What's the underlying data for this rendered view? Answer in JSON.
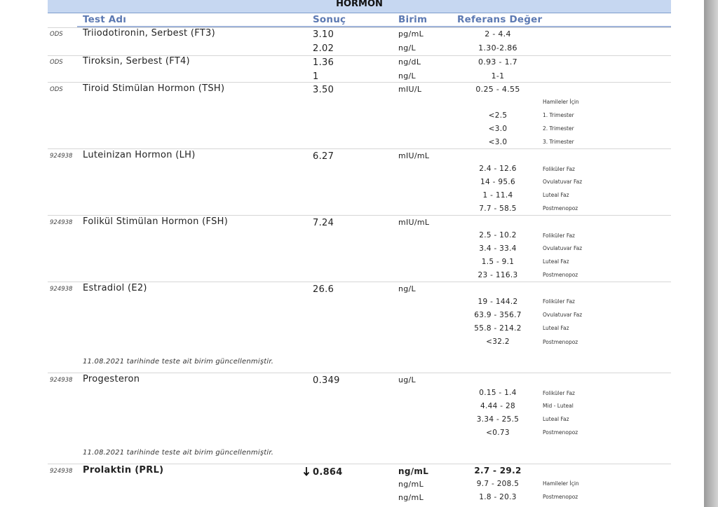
{
  "section_title": "HORMON",
  "headers": {
    "test_name": "Test Adı",
    "result": "Sonuç",
    "unit": "Birim",
    "reference": "Referans Değer"
  },
  "tests": [
    {
      "code": "ODS",
      "name": "Triiodotironin, Serbest (FT3)",
      "result": "3.10",
      "unit": "pg/mL",
      "reference": "2 - 4.4",
      "extra": [
        {
          "result": "2.02",
          "unit": "ng/L",
          "reference": "1.30-2.86"
        }
      ]
    },
    {
      "code": "ODS",
      "name": "Tiroksin, Serbest (FT4)",
      "result": "1.36",
      "unit": "ng/dL",
      "reference": "0.93 - 1.7",
      "extra": [
        {
          "result": "1",
          "unit": "ng/L",
          "reference": "1-1"
        }
      ]
    },
    {
      "code": "ODS",
      "name": "Tiroid Stimülan Hormon (TSH)",
      "result": "3.50",
      "unit": "mIU/L",
      "reference": "0.25 - 4.55",
      "sub_title": "Hamileler İçin",
      "sub_ranges": [
        {
          "range": "<2.5",
          "label": "1. Trimester"
        },
        {
          "range": "<3.0",
          "label": "2. Trimester"
        },
        {
          "range": "<3.0",
          "label": "3. Trimester"
        }
      ]
    },
    {
      "code": "924938",
      "name": "Luteinizan Hormon (LH)",
      "result": "6.27",
      "unit": "mIU/mL",
      "sub_ranges": [
        {
          "range": "2.4 - 12.6",
          "label": "Foliküler Faz"
        },
        {
          "range": "14 - 95.6",
          "label": "Ovulatuvar Faz"
        },
        {
          "range": "1 - 11.4",
          "label": "Luteal Faz"
        },
        {
          "range": "7.7 - 58.5",
          "label": "Postmenopoz"
        }
      ]
    },
    {
      "code": "924938",
      "name": "Folikül Stimülan Hormon (FSH)",
      "result": "7.24",
      "unit": "mIU/mL",
      "sub_ranges": [
        {
          "range": "2.5 - 10.2",
          "label": "Foliküler Faz"
        },
        {
          "range": "3.4 - 33.4",
          "label": "Ovulatuvar Faz"
        },
        {
          "range": "1.5 - 9.1",
          "label": "Luteal Faz"
        },
        {
          "range": "23 - 116.3",
          "label": "Postmenopoz"
        }
      ]
    },
    {
      "code": "924938",
      "name": "Estradiol (E2)",
      "result": "26.6",
      "unit": "ng/L",
      "sub_ranges": [
        {
          "range": "19 - 144.2",
          "label": "Foliküler Faz"
        },
        {
          "range": "63.9 - 356.7",
          "label": "Ovulatuvar Faz"
        },
        {
          "range": "55.8 - 214.2",
          "label": "Luteal Faz"
        },
        {
          "range": "<32.2",
          "label": "Postmenopoz"
        }
      ],
      "note": "11.08.2021 tarihinde teste ait birim güncellenmiştir."
    },
    {
      "code": "924938",
      "name": "Progesteron",
      "result": "0.349",
      "unit": "ug/L",
      "sub_ranges": [
        {
          "range": "0.15 - 1.4",
          "label": "Foliküler Faz"
        },
        {
          "range": "4.44 - 28",
          "label": "Mid - Luteal"
        },
        {
          "range": "3.34 - 25.5",
          "label": "Luteal Faz"
        },
        {
          "range": "<0.73",
          "label": "Postmenopoz"
        }
      ],
      "note": "11.08.2021 tarihinde teste ait birim güncellenmiştir."
    },
    {
      "code": "924938",
      "name": "Prolaktin (PRL)",
      "result": "0.864",
      "flag": "low",
      "flag_icon": "arrow-down-icon",
      "unit": "ng/mL",
      "reference": "2.7 - 29.2",
      "bold": true,
      "sub_ranges": [
        {
          "unit": "ng/mL",
          "range": "9.7 - 208.5",
          "label": "Hamileler İçin"
        },
        {
          "unit": "ng/mL",
          "range": "1.8 - 20.3",
          "label": "Postmenopoz"
        }
      ]
    }
  ]
}
